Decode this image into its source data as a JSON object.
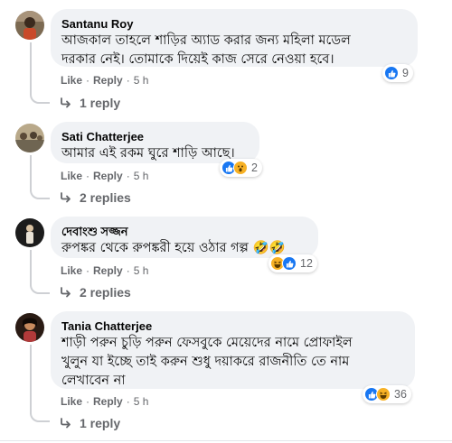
{
  "comments": [
    {
      "author": "Santanu Roy",
      "lines": [
        "আজকাল তাহলে শাড়ির অ্যাড করার জন্য মহিলা মডেল",
        "দরকার নেই। তোমাকে দিয়েই কাজ সেরে নেওয়া হবে।"
      ],
      "reactions": {
        "icons": [
          "like-icon"
        ],
        "count": "9"
      },
      "actions": {
        "like": "Like",
        "reply": "Reply",
        "time": "5 h"
      },
      "replies": "1 reply"
    },
    {
      "author": "Sati Chatterjee",
      "lines": [
        "আমার এই রকম ঘুরে শাড়ি আছে।"
      ],
      "reactions": {
        "icons": [
          "like-icon",
          "wow-icon"
        ],
        "count": "2"
      },
      "actions": {
        "like": "Like",
        "reply": "Reply",
        "time": "5 h"
      },
      "replies": "2 replies"
    },
    {
      "author": "দেবাংশু সজ্জন",
      "lines": [
        "রুপঙ্কর থেকে রুপঙ্করী হয়ে ওঠার গল্প 🤣🤣"
      ],
      "reactions": {
        "icons": [
          "haha-icon",
          "like-icon"
        ],
        "count": "12"
      },
      "actions": {
        "like": "Like",
        "reply": "Reply",
        "time": "5 h"
      },
      "replies": "2 replies"
    },
    {
      "author": "Tania Chatterjee",
      "lines": [
        "শাড়ী পরুন চুড়ি পরুন ফেসবুকে মেয়েদের নামে প্রোফাইল",
        "খুলুন যা ইচ্ছে তাই করুন শুধু দয়াকরে রাজনীতি তে নাম",
        "লেখাবেন না"
      ],
      "reactions": {
        "icons": [
          "like-icon",
          "haha-icon"
        ],
        "count": "36"
      },
      "actions": {
        "like": "Like",
        "reply": "Reply",
        "time": "5 h"
      },
      "replies": "1 reply"
    }
  ],
  "separator": "·",
  "colors": {
    "like": "#1877f2",
    "haha": "#f7b125",
    "secondary_text": "#65676b",
    "bubble": "#f0f2f5"
  }
}
